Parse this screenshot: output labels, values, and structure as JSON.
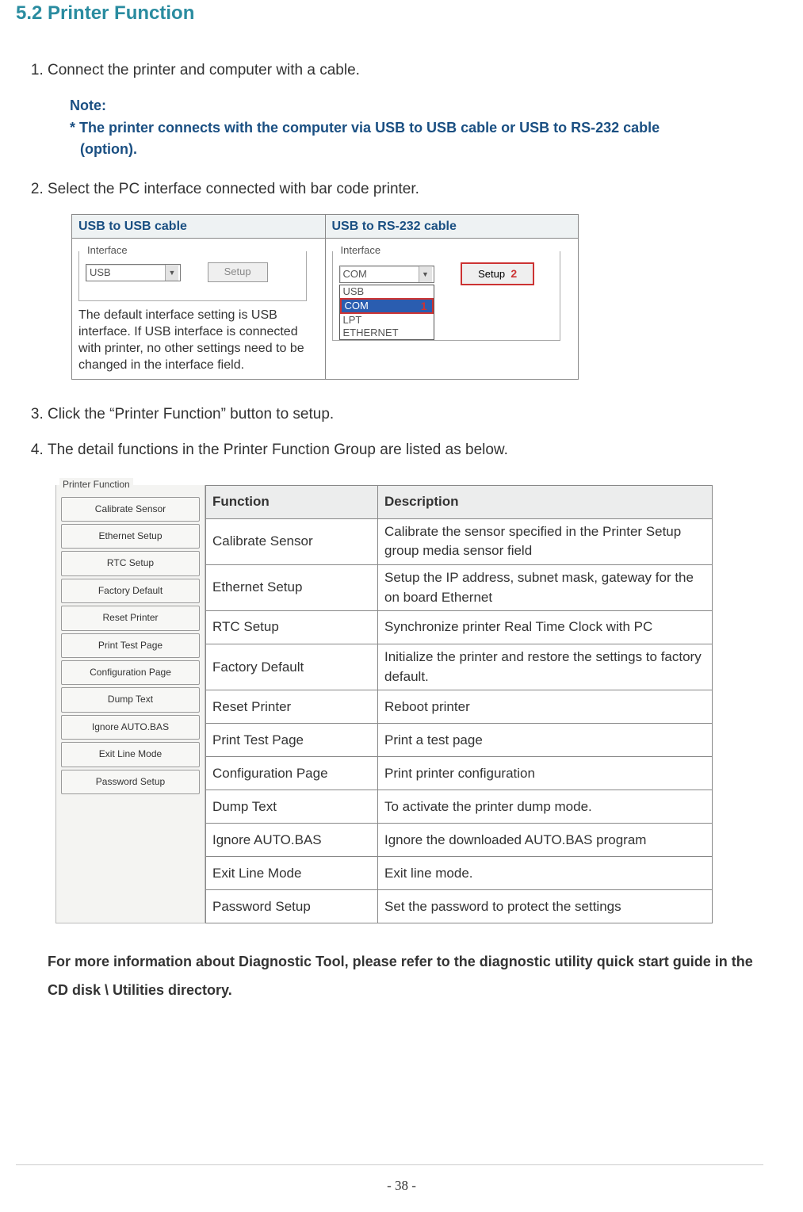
{
  "heading": "5.2 Printer Function",
  "steps": {
    "s1": "Connect the printer and computer with a cable.",
    "s2": "Select the PC interface connected with bar code printer.",
    "s3": "Click the “Printer Function” button to setup.",
    "s4": "The detail functions in the Printer Function Group are listed as below."
  },
  "note": {
    "label": "Note:",
    "line1": "* The printer connects with the computer via USB to USB cable or USB to RS-232 cable",
    "line2": "(option)."
  },
  "iface_table": {
    "col1_header": "USB to USB cable",
    "col2_header": "USB to RS-232 cable",
    "group_label": "Interface",
    "usb_combo_value": "USB",
    "com_combo_value": "COM",
    "setup_btn": "Setup",
    "options": [
      "USB",
      "COM",
      "LPT",
      "ETHERNET"
    ],
    "callout_1": "1",
    "callout_2": "2",
    "usb_note": "The default interface setting is USB interface. If USB interface is connected with printer, no other settings need to be changed in the interface field."
  },
  "panel": {
    "legend": "Printer Function",
    "buttons": [
      "Calibrate Sensor",
      "Ethernet Setup",
      "RTC Setup",
      "Factory Default",
      "Reset Printer",
      "Print Test Page",
      "Configuration Page",
      "Dump Text",
      "Ignore AUTO.BAS",
      "Exit Line Mode",
      "Password Setup"
    ]
  },
  "func_table": {
    "h1": "Function",
    "h2": "Description",
    "rows": [
      {
        "f": "Calibrate Sensor",
        "d": "Calibrate the sensor specified in the Printer Setup group media sensor field"
      },
      {
        "f": "Ethernet Setup",
        "d": "Setup the IP address, subnet mask, gateway for the on board Ethernet"
      },
      {
        "f": "RTC Setup",
        "d": "Synchronize printer Real Time Clock with PC"
      },
      {
        "f": "Factory Default",
        "d": "Initialize the printer and restore the settings to factory default."
      },
      {
        "f": "Reset Printer",
        "d": "Reboot printer"
      },
      {
        "f": "Print Test Page",
        "d": "Print a test page"
      },
      {
        "f": "Configuration Page",
        "d": "Print printer configuration"
      },
      {
        "f": "Dump Text",
        "d": "To activate the printer dump mode."
      },
      {
        "f": "Ignore AUTO.BAS",
        "d": "Ignore the downloaded AUTO.BAS program"
      },
      {
        "f": "Exit Line Mode",
        "d": "Exit line mode."
      },
      {
        "f": "Password Setup",
        "d": "Set the password to protect the settings"
      }
    ]
  },
  "footer": "For more information about Diagnostic Tool, please refer to the diagnostic utility quick start guide in the CD disk \\ Utilities directory.",
  "page_number": "38"
}
